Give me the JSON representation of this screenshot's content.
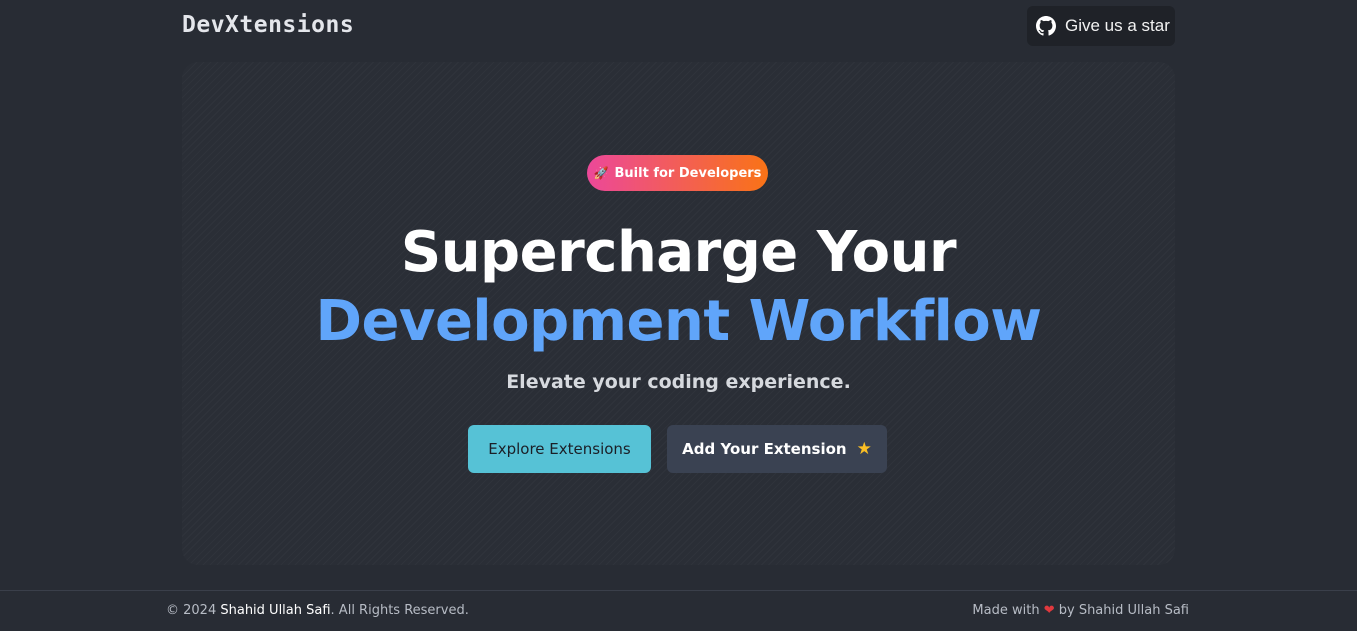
{
  "navbar": {
    "logo": "DevXtensions",
    "star_button_label": "Give us a star",
    "star_button_icon": "github-icon"
  },
  "hero": {
    "badge": {
      "icon": "rocket-icon",
      "label": "Built for Developers",
      "gradient": [
        "#ec4899",
        "#f97316"
      ]
    },
    "headline_line1": "Supercharge Your",
    "headline_line2": "Development Workflow",
    "headline_accent_color": "#60a5fa",
    "subtitle": "Elevate your coding experience.",
    "primary_button": {
      "label": "Explore Extensions",
      "color": "#56c2d6"
    },
    "secondary_button": {
      "label": "Add Your Extension",
      "icon": "star-icon",
      "color": "#3a4252"
    }
  },
  "footer": {
    "copyright_prefix": "© 2024 ",
    "copyright_name": "Shahid Ullah Safi",
    "copyright_suffix": ". All Rights Reserved.",
    "made_with_prefix": "Made with ",
    "made_with_icon": "heart-icon",
    "made_with_suffix": " by Shahid Ullah Safi"
  },
  "colors": {
    "background": "#282c34",
    "text_primary": "#ffffff",
    "text_secondary": "#b7bcc5"
  }
}
